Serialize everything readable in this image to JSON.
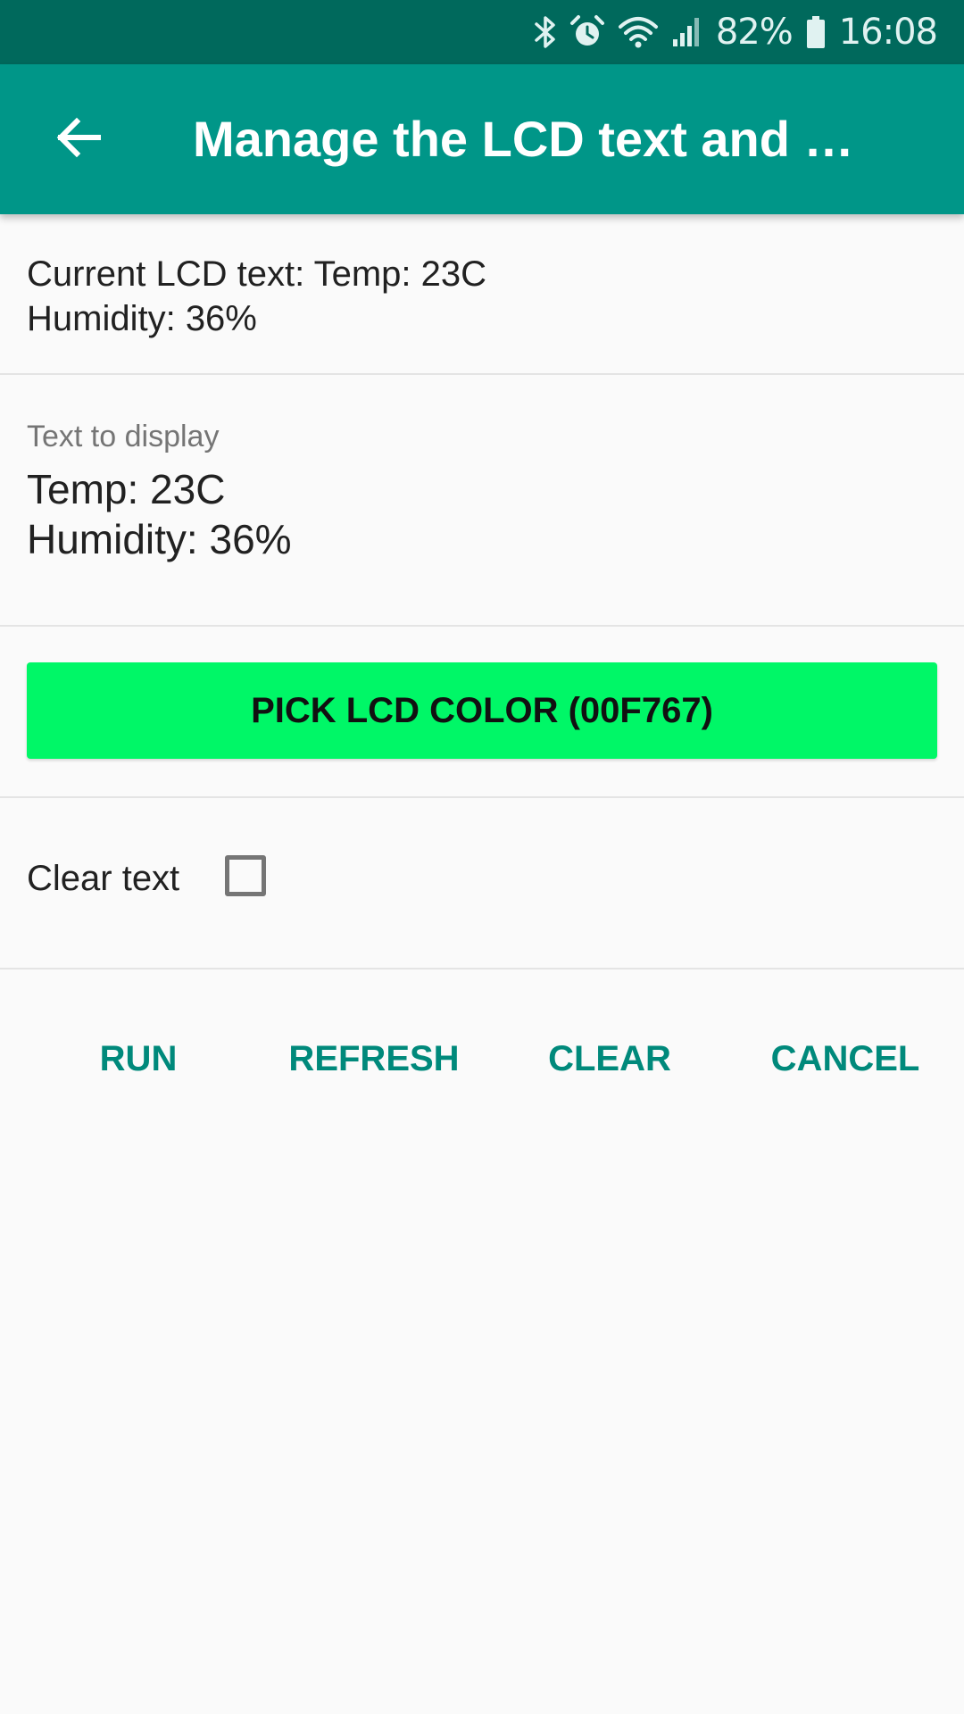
{
  "status_bar": {
    "battery": "82%",
    "time": "16:08",
    "icons": [
      "bluetooth-icon",
      "alarm-icon",
      "wifi-icon",
      "signal-icon",
      "battery-icon"
    ]
  },
  "app_bar": {
    "title": "Manage the LCD text and …",
    "back_icon": "arrow-back-icon",
    "background": "#009688"
  },
  "current_lcd": {
    "text": "Current LCD text: Temp: 23C\nHumidity: 36%"
  },
  "text_field": {
    "label": "Text to display",
    "value": "Temp: 23C\nHumidity: 36%"
  },
  "color_button": {
    "label": "PICK LCD COLOR (00F767)",
    "color": "#00F767"
  },
  "clear_option": {
    "label": "Clear text",
    "checked": false
  },
  "actions": {
    "run": "RUN",
    "refresh": "REFRESH",
    "clear": "CLEAR",
    "cancel": "CANCEL",
    "color": "#00897b"
  }
}
